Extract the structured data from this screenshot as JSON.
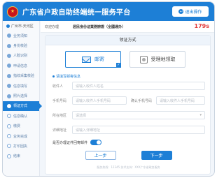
{
  "header": {
    "title": "广东省户政自助终端统一服务平台",
    "logo_glyph": "★",
    "exit_label": "退出操作",
    "exit_icon": "exit-icon"
  },
  "sidebar": {
    "location": "广州市-天河区",
    "items": [
      {
        "label": "业务须知",
        "state": "done"
      },
      {
        "label": "身份核验",
        "state": "done"
      },
      {
        "label": "人脸识别",
        "state": "done"
      },
      {
        "label": "申请信息",
        "state": "done"
      },
      {
        "label": "指纹采集核验",
        "state": "done"
      },
      {
        "label": "信息填写",
        "state": "done"
      },
      {
        "label": "照片选择",
        "state": "done"
      },
      {
        "label": "领证方式",
        "state": "active"
      },
      {
        "label": "信息确认",
        "state": "todo"
      },
      {
        "label": "缴费",
        "state": "todo"
      },
      {
        "label": "业务完成",
        "state": "todo"
      },
      {
        "label": "打印回执",
        "state": "todo"
      },
      {
        "label": "结束",
        "state": "todo"
      }
    ]
  },
  "infobar": {
    "prefix": "欢迎办理",
    "business": "居民身份证業務辦證（全國通办）",
    "countdown": "179s"
  },
  "panel": {
    "title": "领证方式",
    "methods": [
      {
        "label": "邮寄",
        "icon": "mail-icon",
        "selected": true
      },
      {
        "label": "受理地领取",
        "icon": "pickup-site-icon",
        "selected": false
      }
    ],
    "section_title": "请填写邮寄信息",
    "fields": {
      "recipient": {
        "label": "收件人",
        "placeholder": "请输入收件人姓名"
      },
      "phone": {
        "label": "手机号码",
        "placeholder": "请输入收件人手机号码"
      },
      "confirm_phone": {
        "label": "确认手机号码",
        "placeholder": "请输入收件人手机号码"
      },
      "region": {
        "label": "所在地区",
        "placeholder": "请选择"
      },
      "address": {
        "label": "详细地址",
        "placeholder": "请输入详细地址"
      }
    },
    "toggle_label": "是否办理证件回寄邮件",
    "toggle_on": true
  },
  "buttons": {
    "prev": "上一步",
    "next": "下一步"
  },
  "footer": "服务热线：12345 技术支持：XXX广东省政务服务"
}
